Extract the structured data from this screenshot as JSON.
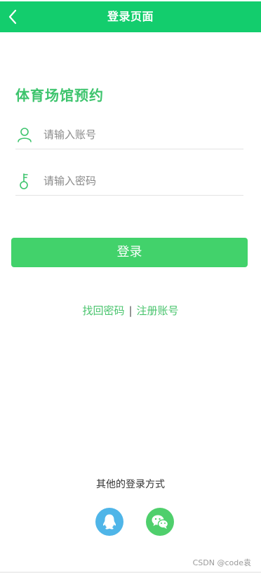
{
  "header": {
    "title": "登录页面",
    "back_icon": "chevron-left-icon"
  },
  "app_title": "体育场馆预约",
  "form": {
    "username_placeholder": "请输入账号",
    "username_icon": "user-icon",
    "password_placeholder": "请输入密码",
    "password_icon": "key-icon",
    "login_label": "登录"
  },
  "links": {
    "forgot_password": "找回密码",
    "separator": "|",
    "register": "注册账号"
  },
  "other_login": {
    "label": "其他的登录方式",
    "providers": [
      {
        "name": "qq",
        "icon": "qq-icon",
        "color": "#4fb5e8"
      },
      {
        "name": "wechat",
        "icon": "wechat-icon",
        "color": "#4fcf6c"
      }
    ]
  },
  "watermark": "CSDN @code袁",
  "colors": {
    "header_bg": "#13cd6d",
    "accent": "#42d26b",
    "title_green": "#3dc46d"
  }
}
